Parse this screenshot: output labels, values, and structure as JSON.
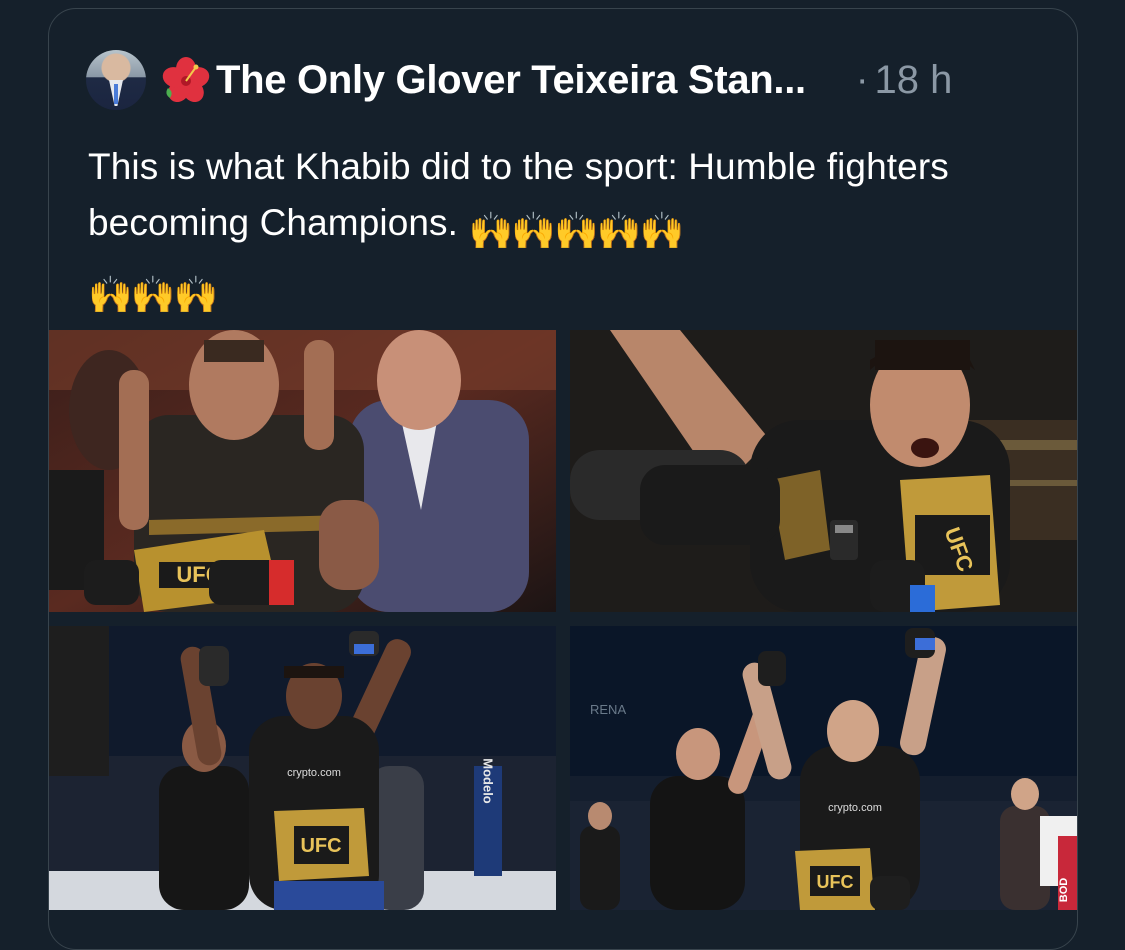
{
  "tweet": {
    "display_name": "The Only Glover Teixeira Stan...",
    "separator": "·",
    "timestamp": "18 h",
    "text": "This is what Khabib did to the sport: Humble fighters becoming Champions.",
    "emoji_line1": "🙌🙌🙌🙌🙌",
    "emoji_line2": "🙌🙌🙌",
    "name_emoji": "hibiscus-icon",
    "avatar": "avatar-man-in-suit"
  },
  "media": {
    "photos": [
      {
        "id": "photo-1",
        "icon": "fighter-with-belt",
        "belt_text": "UFC",
        "colors": {
          "shorts": "#d62c2c"
        }
      },
      {
        "id": "photo-2",
        "icon": "fighter-shouting-with-belt",
        "belt_text": "UFC"
      },
      {
        "id": "photo-3",
        "icon": "fighter-arms-raised",
        "belt_text": "UFC",
        "sponsor": "crypto.com",
        "banner": "Modelo"
      },
      {
        "id": "photo-4",
        "icon": "fighter-hand-raised-by-referee",
        "belt_text": "UFC",
        "sponsor": "crypto.com",
        "side_text": "BOD",
        "arena": "RENA"
      }
    ]
  },
  "colors": {
    "background": "#15202b",
    "border": "#38444d",
    "primary_text": "#ffffff",
    "secondary_text": "#8b98a5"
  }
}
